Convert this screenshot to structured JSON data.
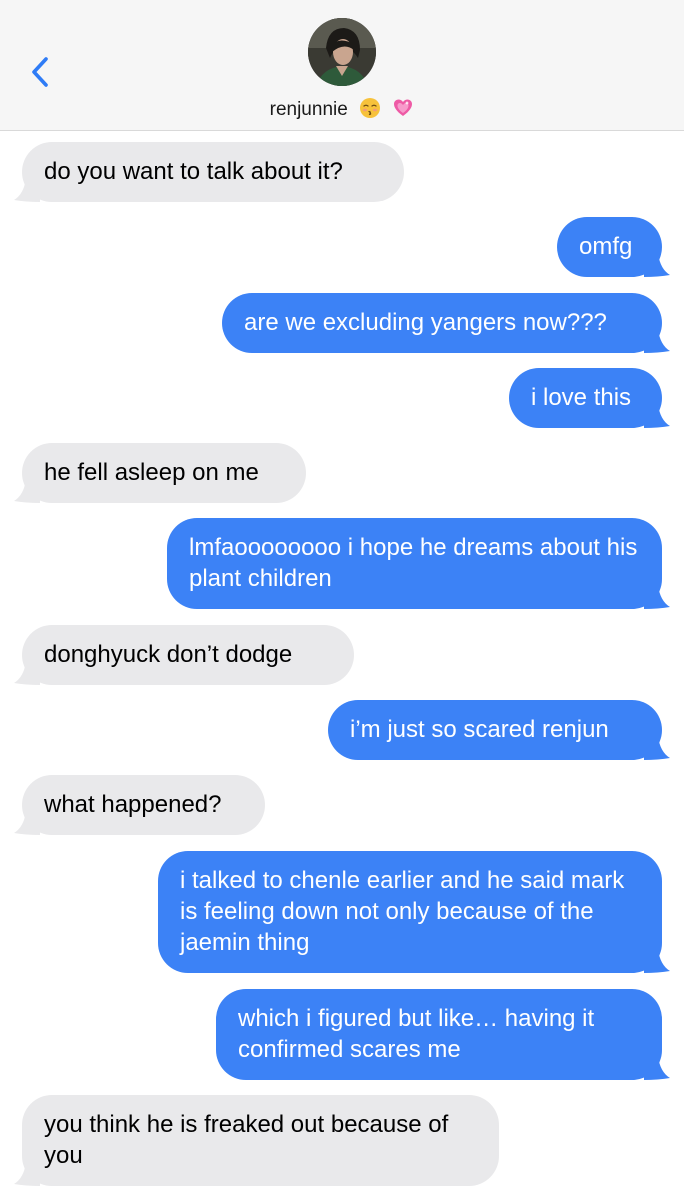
{
  "header": {
    "contact_name": "renjunnie",
    "emojis": [
      "kissing-face-with-closed-eyes-icon",
      "sparkling-heart-icon"
    ]
  },
  "colors": {
    "sent_bubble": "#3c82f6",
    "received_bubble": "#e9e9eb",
    "accent": "#2f7cf6"
  },
  "messages": [
    {
      "sender": "them",
      "text": "do you want to talk about it?"
    },
    {
      "sender": "me",
      "text": "omfg"
    },
    {
      "sender": "me",
      "text": "are we excluding yangers now???"
    },
    {
      "sender": "me",
      "text": "i love this"
    },
    {
      "sender": "them",
      "text": "he fell asleep on me"
    },
    {
      "sender": "me",
      "text": "lmfaoooooooo i hope he dreams about his plant children"
    },
    {
      "sender": "them",
      "text": "donghyuck don’t dodge"
    },
    {
      "sender": "me",
      "text": "i’m just so scared renjun"
    },
    {
      "sender": "them",
      "text": "what happened?"
    },
    {
      "sender": "me",
      "text": "i talked to chenle earlier and he said mark is feeling down not only because of the jaemin thing"
    },
    {
      "sender": "me",
      "text": "which i figured but like… having it confirmed scares me"
    },
    {
      "sender": "them",
      "text": "you think he is freaked out because of you"
    }
  ]
}
